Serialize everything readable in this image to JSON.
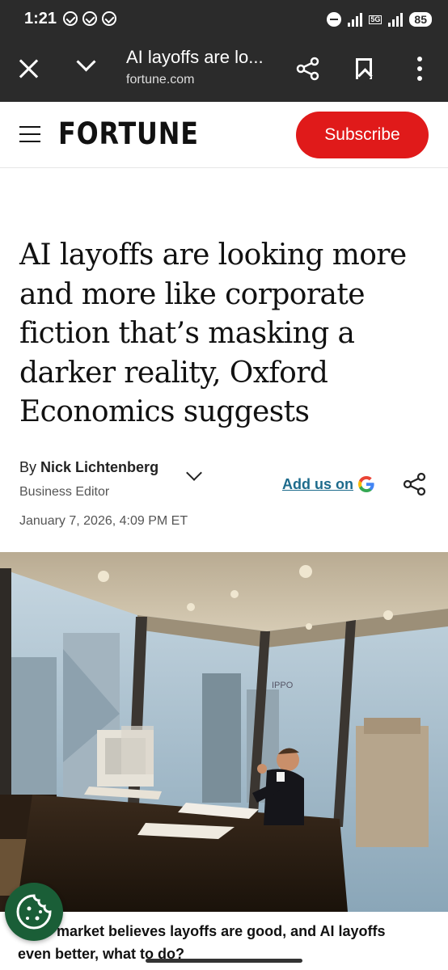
{
  "status": {
    "time": "1:21",
    "network": "5G",
    "battery": "85"
  },
  "browser": {
    "page_title": "AI layoffs are lo...",
    "domain": "fortune.com"
  },
  "site": {
    "logo": "FORTUNE",
    "subscribe_label": "Subscribe"
  },
  "article": {
    "headline": "AI layoffs are looking more and more like corporate fiction that’s masking a darker reality, Oxford Economics suggests",
    "by_prefix": "By",
    "author": "Nick Lichtenberg",
    "author_role": "Business Editor",
    "add_us_label": "Add us on",
    "date": "January 7, 2026, 4:09 PM ET",
    "image_text": "IPPO",
    "caption": "If the market believes layoffs are good, and AI layoffs even better, what to do?"
  },
  "icons": [
    "check-circle-icon",
    "dnd-icon",
    "signal-icon",
    "battery-icon",
    "close-icon",
    "chevron-down-icon",
    "share-icon",
    "bookmark-icon",
    "more-vert-icon",
    "hamburger-icon",
    "google-icon",
    "cookie-icon"
  ],
  "colors": {
    "browser_bar": "#2b2b2b",
    "subscribe": "#e01a1a",
    "link": "#1d6b8c",
    "cookie_button": "#1a5e37"
  }
}
